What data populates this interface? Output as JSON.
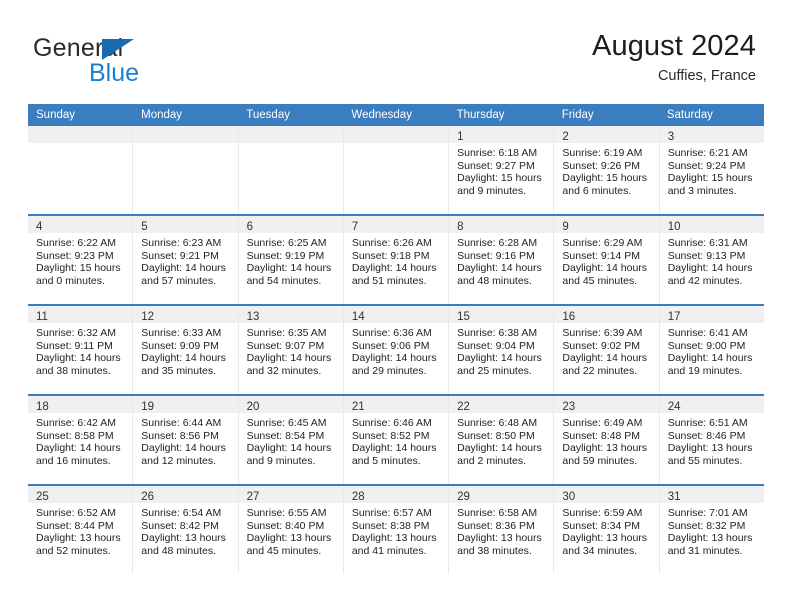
{
  "brand": {
    "name_top": "General",
    "name_bottom": "Blue",
    "accent_color": "#1a7fd4",
    "triangle_color": "#1a6ab3"
  },
  "header": {
    "title": "August 2024",
    "subtitle": "Cuffies, France"
  },
  "theme": {
    "header_blue": "#3a7ebf",
    "day_band": "#f0f0f0",
    "cell_border": "#e9e9e9"
  },
  "weekdays": [
    "Sunday",
    "Monday",
    "Tuesday",
    "Wednesday",
    "Thursday",
    "Friday",
    "Saturday"
  ],
  "weeks": [
    [
      {
        "day": "",
        "sunrise": "",
        "sunset": "",
        "daylight": "",
        "daylight2": ""
      },
      {
        "day": "",
        "sunrise": "",
        "sunset": "",
        "daylight": "",
        "daylight2": ""
      },
      {
        "day": "",
        "sunrise": "",
        "sunset": "",
        "daylight": "",
        "daylight2": ""
      },
      {
        "day": "",
        "sunrise": "",
        "sunset": "",
        "daylight": "",
        "daylight2": ""
      },
      {
        "day": "1",
        "sunrise": "Sunrise: 6:18 AM",
        "sunset": "Sunset: 9:27 PM",
        "daylight": "Daylight: 15 hours",
        "daylight2": "and 9 minutes."
      },
      {
        "day": "2",
        "sunrise": "Sunrise: 6:19 AM",
        "sunset": "Sunset: 9:26 PM",
        "daylight": "Daylight: 15 hours",
        "daylight2": "and 6 minutes."
      },
      {
        "day": "3",
        "sunrise": "Sunrise: 6:21 AM",
        "sunset": "Sunset: 9:24 PM",
        "daylight": "Daylight: 15 hours",
        "daylight2": "and 3 minutes."
      }
    ],
    [
      {
        "day": "4",
        "sunrise": "Sunrise: 6:22 AM",
        "sunset": "Sunset: 9:23 PM",
        "daylight": "Daylight: 15 hours",
        "daylight2": "and 0 minutes."
      },
      {
        "day": "5",
        "sunrise": "Sunrise: 6:23 AM",
        "sunset": "Sunset: 9:21 PM",
        "daylight": "Daylight: 14 hours",
        "daylight2": "and 57 minutes."
      },
      {
        "day": "6",
        "sunrise": "Sunrise: 6:25 AM",
        "sunset": "Sunset: 9:19 PM",
        "daylight": "Daylight: 14 hours",
        "daylight2": "and 54 minutes."
      },
      {
        "day": "7",
        "sunrise": "Sunrise: 6:26 AM",
        "sunset": "Sunset: 9:18 PM",
        "daylight": "Daylight: 14 hours",
        "daylight2": "and 51 minutes."
      },
      {
        "day": "8",
        "sunrise": "Sunrise: 6:28 AM",
        "sunset": "Sunset: 9:16 PM",
        "daylight": "Daylight: 14 hours",
        "daylight2": "and 48 minutes."
      },
      {
        "day": "9",
        "sunrise": "Sunrise: 6:29 AM",
        "sunset": "Sunset: 9:14 PM",
        "daylight": "Daylight: 14 hours",
        "daylight2": "and 45 minutes."
      },
      {
        "day": "10",
        "sunrise": "Sunrise: 6:31 AM",
        "sunset": "Sunset: 9:13 PM",
        "daylight": "Daylight: 14 hours",
        "daylight2": "and 42 minutes."
      }
    ],
    [
      {
        "day": "11",
        "sunrise": "Sunrise: 6:32 AM",
        "sunset": "Sunset: 9:11 PM",
        "daylight": "Daylight: 14 hours",
        "daylight2": "and 38 minutes."
      },
      {
        "day": "12",
        "sunrise": "Sunrise: 6:33 AM",
        "sunset": "Sunset: 9:09 PM",
        "daylight": "Daylight: 14 hours",
        "daylight2": "and 35 minutes."
      },
      {
        "day": "13",
        "sunrise": "Sunrise: 6:35 AM",
        "sunset": "Sunset: 9:07 PM",
        "daylight": "Daylight: 14 hours",
        "daylight2": "and 32 minutes."
      },
      {
        "day": "14",
        "sunrise": "Sunrise: 6:36 AM",
        "sunset": "Sunset: 9:06 PM",
        "daylight": "Daylight: 14 hours",
        "daylight2": "and 29 minutes."
      },
      {
        "day": "15",
        "sunrise": "Sunrise: 6:38 AM",
        "sunset": "Sunset: 9:04 PM",
        "daylight": "Daylight: 14 hours",
        "daylight2": "and 25 minutes."
      },
      {
        "day": "16",
        "sunrise": "Sunrise: 6:39 AM",
        "sunset": "Sunset: 9:02 PM",
        "daylight": "Daylight: 14 hours",
        "daylight2": "and 22 minutes."
      },
      {
        "day": "17",
        "sunrise": "Sunrise: 6:41 AM",
        "sunset": "Sunset: 9:00 PM",
        "daylight": "Daylight: 14 hours",
        "daylight2": "and 19 minutes."
      }
    ],
    [
      {
        "day": "18",
        "sunrise": "Sunrise: 6:42 AM",
        "sunset": "Sunset: 8:58 PM",
        "daylight": "Daylight: 14 hours",
        "daylight2": "and 16 minutes."
      },
      {
        "day": "19",
        "sunrise": "Sunrise: 6:44 AM",
        "sunset": "Sunset: 8:56 PM",
        "daylight": "Daylight: 14 hours",
        "daylight2": "and 12 minutes."
      },
      {
        "day": "20",
        "sunrise": "Sunrise: 6:45 AM",
        "sunset": "Sunset: 8:54 PM",
        "daylight": "Daylight: 14 hours",
        "daylight2": "and 9 minutes."
      },
      {
        "day": "21",
        "sunrise": "Sunrise: 6:46 AM",
        "sunset": "Sunset: 8:52 PM",
        "daylight": "Daylight: 14 hours",
        "daylight2": "and 5 minutes."
      },
      {
        "day": "22",
        "sunrise": "Sunrise: 6:48 AM",
        "sunset": "Sunset: 8:50 PM",
        "daylight": "Daylight: 14 hours",
        "daylight2": "and 2 minutes."
      },
      {
        "day": "23",
        "sunrise": "Sunrise: 6:49 AM",
        "sunset": "Sunset: 8:48 PM",
        "daylight": "Daylight: 13 hours",
        "daylight2": "and 59 minutes."
      },
      {
        "day": "24",
        "sunrise": "Sunrise: 6:51 AM",
        "sunset": "Sunset: 8:46 PM",
        "daylight": "Daylight: 13 hours",
        "daylight2": "and 55 minutes."
      }
    ],
    [
      {
        "day": "25",
        "sunrise": "Sunrise: 6:52 AM",
        "sunset": "Sunset: 8:44 PM",
        "daylight": "Daylight: 13 hours",
        "daylight2": "and 52 minutes."
      },
      {
        "day": "26",
        "sunrise": "Sunrise: 6:54 AM",
        "sunset": "Sunset: 8:42 PM",
        "daylight": "Daylight: 13 hours",
        "daylight2": "and 48 minutes."
      },
      {
        "day": "27",
        "sunrise": "Sunrise: 6:55 AM",
        "sunset": "Sunset: 8:40 PM",
        "daylight": "Daylight: 13 hours",
        "daylight2": "and 45 minutes."
      },
      {
        "day": "28",
        "sunrise": "Sunrise: 6:57 AM",
        "sunset": "Sunset: 8:38 PM",
        "daylight": "Daylight: 13 hours",
        "daylight2": "and 41 minutes."
      },
      {
        "day": "29",
        "sunrise": "Sunrise: 6:58 AM",
        "sunset": "Sunset: 8:36 PM",
        "daylight": "Daylight: 13 hours",
        "daylight2": "and 38 minutes."
      },
      {
        "day": "30",
        "sunrise": "Sunrise: 6:59 AM",
        "sunset": "Sunset: 8:34 PM",
        "daylight": "Daylight: 13 hours",
        "daylight2": "and 34 minutes."
      },
      {
        "day": "31",
        "sunrise": "Sunrise: 7:01 AM",
        "sunset": "Sunset: 8:32 PM",
        "daylight": "Daylight: 13 hours",
        "daylight2": "and 31 minutes."
      }
    ]
  ]
}
